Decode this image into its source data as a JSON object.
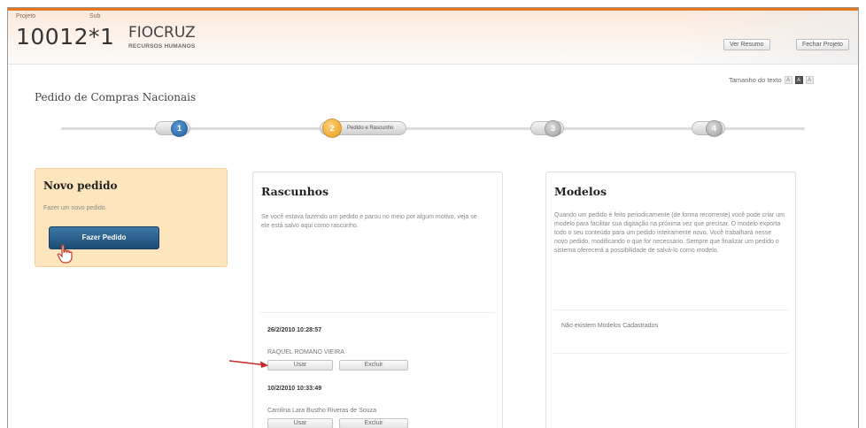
{
  "header": {
    "project_label": "Projeto",
    "base_label": "Sub",
    "project_number": "10012*1",
    "org_name": "FIOCRUZ",
    "org_subtitle": "RECURSOS HUMANOS",
    "btn_ver_resumo": "Ver Resumo",
    "btn_fechar_projeto": "Fechar Projeto"
  },
  "text_size": {
    "label": "Tamanho do texto",
    "options": [
      "A",
      "A",
      "A"
    ]
  },
  "page_title": "Pedido de Compras Nacionais",
  "steps": [
    {
      "number": "1",
      "label": ""
    },
    {
      "number": "2",
      "label": "Pedido e Rascunho"
    },
    {
      "number": "3",
      "label": ""
    },
    {
      "number": "4",
      "label": ""
    }
  ],
  "novo_pedido": {
    "title": "Novo pedido",
    "description": "Fazer um novo pedido.",
    "button": "Fazer Pedido"
  },
  "rascunhos": {
    "title": "Rascunhos",
    "description": "Se você estava fazendo um pedido e parou no meio por algum motivo, veja se ele está salvo aqui como rascunho.",
    "items": [
      {
        "date": "26/2/2010 10:28:57",
        "user": "RAQUEL ROMANO VIEIRA",
        "use": "Usar",
        "delete": "Excluir"
      },
      {
        "date": "10/2/2010 10:33:49",
        "user": "Carolina Lara Bustho Riveras de Souza",
        "use": "Usar",
        "delete": "Excluir"
      }
    ]
  },
  "modelos": {
    "title": "Modelos",
    "description": "Quando um pedido é feito periodicamente (de forma recorrente) você pode criar um modelo para facilitar sua digitação na próxima vez que precisar. O modelo exporta todo o seu conteúdo para um pedido inteiramente novo. Você trabalhará nesse novo pedido, modificando o que for necessário. Sempre que finalizar um pedido o sistema oferecerá a possibilidade de salvá-lo como modelo.",
    "empty": "Não existem Modelos Cadastrados"
  },
  "colors": {
    "header_accent": "#e4761b",
    "primary_button": "#2b5f8c",
    "novo_bg": "#fde6be",
    "step_active": "#e49a15",
    "step_done": "#1f5f9c"
  }
}
